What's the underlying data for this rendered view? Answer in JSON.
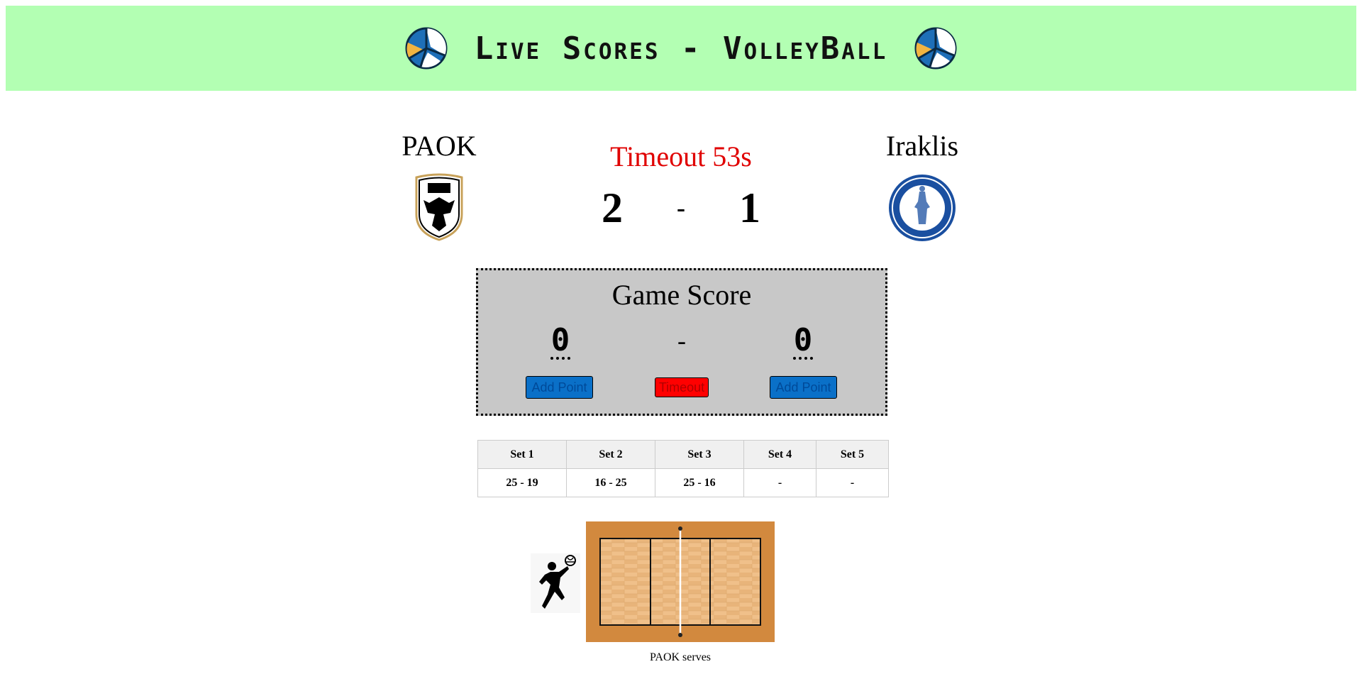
{
  "header": {
    "title": "Live Scores - VolleyBall",
    "left_icon": "volleyball-icon",
    "right_icon": "volleyball-icon"
  },
  "home_team": {
    "name": "PAOK",
    "logo": "paok-crest-icon"
  },
  "away_team": {
    "name": "Iraklis",
    "logo": "iraklis-crest-icon"
  },
  "match": {
    "timeout_text": "Timeout 53s",
    "home_sets": "2",
    "separator": "-",
    "away_sets": "1"
  },
  "game_score": {
    "title": "Game Score",
    "home_points": "0",
    "separator": "-",
    "away_points": "0",
    "add_point_label": "Add Point",
    "timeout_label": "Timeout"
  },
  "sets_table": {
    "headers": [
      "Set 1",
      "Set 2",
      "Set 3",
      "Set 4",
      "Set 5"
    ],
    "scores": [
      "25 - 19",
      "16 - 25",
      "25 - 16",
      "-",
      "-"
    ]
  },
  "court": {
    "serve_text": "PAOK serves",
    "player_icon": "volleyball-player-icon"
  },
  "colors": {
    "header_bg": "#b3ffb3",
    "timeout_text": "#e00000",
    "add_point_button": "#0a70c8",
    "timeout_button": "#ff0000",
    "game_box_bg": "#c8c8c8"
  }
}
